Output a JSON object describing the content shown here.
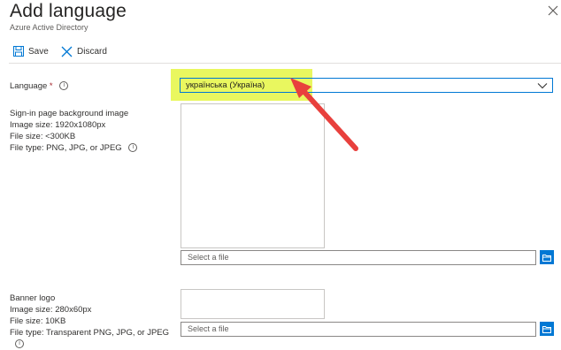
{
  "header": {
    "title": "Add language",
    "subtitle": "Azure Active Directory"
  },
  "toolbar": {
    "save_label": "Save",
    "discard_label": "Discard"
  },
  "form": {
    "language": {
      "label": "Language",
      "required_mark": "*",
      "value": "українська (Україна)"
    },
    "background": {
      "label": "Sign-in page background image",
      "size": "Image size: 1920x1080px",
      "file_size": "File size: <300KB",
      "file_type": "File type: PNG, JPG, or JPEG",
      "placeholder": "Select a file"
    },
    "banner": {
      "label": "Banner logo",
      "size": "Image size: 280x60px",
      "file_size": "File size: 10KB",
      "file_type": "File type: Transparent PNG, JPG, or JPEG",
      "placeholder": "Select a file"
    }
  },
  "colors": {
    "accent": "#0078d4",
    "highlight": "#e9f75f",
    "annotation_arrow": "#e8403d"
  },
  "icons": [
    "save-icon",
    "discard-icon",
    "close-icon",
    "info-icon",
    "chevron-down-icon",
    "folder-icon"
  ]
}
